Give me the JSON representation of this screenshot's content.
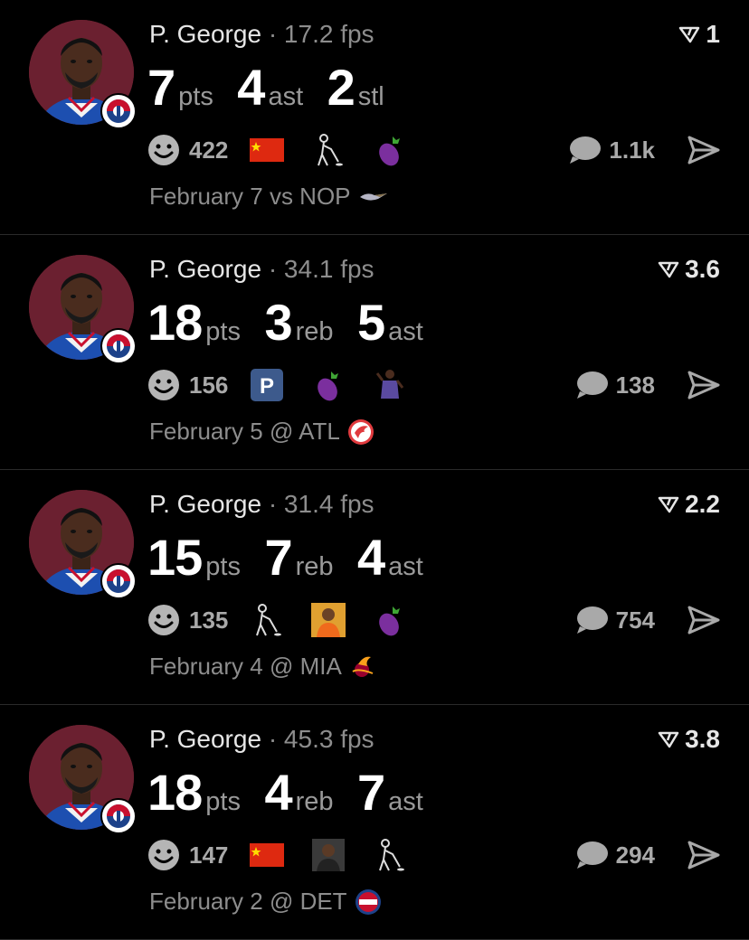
{
  "posts": [
    {
      "player": "P. George",
      "separator": "·",
      "fps": "17.2 fps",
      "rank": "1",
      "stats": [
        {
          "num": "7",
          "label": "pts"
        },
        {
          "num": "4",
          "label": "ast"
        },
        {
          "num": "2",
          "label": "stl"
        }
      ],
      "reaction_count": "422",
      "emojis": [
        "china-flag",
        "golfer",
        "eggplant"
      ],
      "comment_count": "1.1k",
      "game": "February 7 vs NOP",
      "opponent_logo": "pelicans-logo"
    },
    {
      "player": "P. George",
      "separator": "·",
      "fps": "34.1 fps",
      "rank": "3.6",
      "stats": [
        {
          "num": "18",
          "label": "pts"
        },
        {
          "num": "3",
          "label": "reb"
        },
        {
          "num": "5",
          "label": "ast"
        }
      ],
      "reaction_count": "156",
      "emojis": [
        "parking-sign",
        "eggplant",
        "player-image"
      ],
      "comment_count": "138",
      "game": "February 5 @ ATL",
      "opponent_logo": "hawks-logo"
    },
    {
      "player": "P. George",
      "separator": "·",
      "fps": "31.4 fps",
      "rank": "2.2",
      "stats": [
        {
          "num": "15",
          "label": "pts"
        },
        {
          "num": "7",
          "label": "reb"
        },
        {
          "num": "4",
          "label": "ast"
        }
      ],
      "reaction_count": "135",
      "emojis": [
        "golfer",
        "drake-meme",
        "eggplant"
      ],
      "comment_count": "754",
      "game": "February 4 @ MIA",
      "opponent_logo": "heat-logo"
    },
    {
      "player": "P. George",
      "separator": "·",
      "fps": "45.3 fps",
      "rank": "3.8",
      "stats": [
        {
          "num": "18",
          "label": "pts"
        },
        {
          "num": "4",
          "label": "reb"
        },
        {
          "num": "7",
          "label": "ast"
        }
      ],
      "reaction_count": "147",
      "emojis": [
        "china-flag",
        "person-meme",
        "golfer"
      ],
      "comment_count": "294",
      "game": "February 2 @ DET",
      "opponent_logo": "pistons-logo"
    }
  ],
  "colors": {
    "background": "#000000",
    "avatar_bg": "#6b2030",
    "muted": "#8d8d8d"
  }
}
